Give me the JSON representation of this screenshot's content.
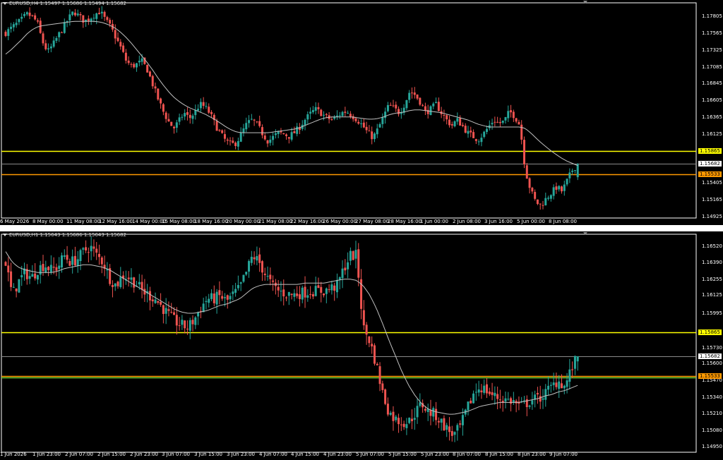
{
  "colors": {
    "background": "#000000",
    "bull": "#26a69a",
    "bear": "#ef5350",
    "ma": "#c0c0c0",
    "axis": "#ffffff",
    "level_yellow": "#ffff00",
    "level_orange": "#ff9900",
    "level_green": "#66cc33",
    "current_price_line": "#8a8a8a"
  },
  "panels": [
    {
      "header": "EURUSD,H4  1.15497 1.15686 1.15494 1.15682",
      "price_labels": [
        "1.17805",
        "1.17565",
        "1.17325",
        "1.17085",
        "1.16845",
        "1.16605",
        "1.16365",
        "1.16125",
        "1.15865",
        "1.15682",
        "1.15533",
        "1.15405",
        "1.15165",
        "1.14925"
      ],
      "time_labels": [
        "6 May 2026",
        "8 May 00:00",
        "11 May 08:00",
        "12 May 16:00",
        "14 May 00:00",
        "15 May 08:00",
        "18 May 16:00",
        "20 May 00:00",
        "21 May 08:00",
        "22 May 16:00",
        "26 May 00:00",
        "27 May 08:00",
        "28 May 16:00",
        "1 Jun 00:00",
        "2 Jun 08:00",
        "3 Jun 16:00",
        "5 Jun 00:00",
        "8 Jun 08:00"
      ],
      "level_tags": [
        {
          "price": "1.15865",
          "color": "#ffff00"
        },
        {
          "price": "1.15682",
          "color": "#ffffff"
        },
        {
          "price": "1.15533",
          "color": "#ff9900"
        }
      ]
    },
    {
      "header": "EURUSD,H1  1.15643 1.15686 1.15643 1.15682",
      "price_labels": [
        "1.16520",
        "1.16390",
        "1.16255",
        "1.16125",
        "1.15995",
        "1.15865",
        "1.15730",
        "1.15682",
        "1.15600",
        "1.15533",
        "1.15470",
        "1.15340",
        "1.15210",
        "1.15080",
        "1.14950"
      ],
      "time_labels": [
        "1 Jun 2026",
        "1 Jun 23:00",
        "2 Jun 07:00",
        "2 Jun 15:00",
        "2 Jun 23:00",
        "3 Jun 07:00",
        "3 Jun 15:00",
        "3 Jun 23:00",
        "4 Jun 07:00",
        "4 Jun 15:00",
        "4 Jun 23:00",
        "5 Jun 07:00",
        "5 Jun 15:00",
        "5 Jun 23:00",
        "8 Jun 07:00",
        "8 Jun 15:00",
        "8 Jun 23:00",
        "9 Jun 07:00"
      ],
      "level_tags": [
        {
          "price": "1.15865",
          "color": "#ffff00"
        },
        {
          "price": "1.15682",
          "color": "#ffffff"
        },
        {
          "price": "1.15533",
          "color": "#ff9900"
        }
      ]
    }
  ],
  "chart_data": [
    {
      "type": "candlestick",
      "symbol": "EURUSD",
      "timeframe": "H4",
      "ohlc_last": {
        "open": 1.15497,
        "high": 1.15686,
        "low": 1.15494,
        "close": 1.15682
      },
      "ylim": [
        1.14925,
        1.1788
      ],
      "x_ticks": [
        "6 May 2026",
        "8 May 00:00",
        "11 May 08:00",
        "12 May 16:00",
        "14 May 00:00",
        "15 May 08:00",
        "18 May 16:00",
        "20 May 00:00",
        "21 May 08:00",
        "22 May 16:00",
        "26 May 00:00",
        "27 May 08:00",
        "28 May 16:00",
        "1 Jun 00:00",
        "2 Jun 08:00",
        "3 Jun 16:00",
        "5 Jun 00:00",
        "8 Jun 08:00"
      ],
      "y_ticks": [
        1.17805,
        1.17565,
        1.17325,
        1.17085,
        1.16845,
        1.16605,
        1.16365,
        1.16125,
        1.15405,
        1.15165,
        1.14925
      ],
      "horizontal_levels": [
        {
          "price": 1.15865,
          "color": "#ffff00"
        },
        {
          "price": 1.15682,
          "color": "#8a8a8a"
        },
        {
          "price": 1.15533,
          "color": "#ff9900"
        }
      ],
      "close_path": [
        1.1752,
        1.1758,
        1.1764,
        1.177,
        1.1778,
        1.1775,
        1.1767,
        1.174,
        1.1725,
        1.1735,
        1.1748,
        1.176,
        1.1772,
        1.1782,
        1.1775,
        1.1768,
        1.1772,
        1.1778,
        1.1782,
        1.177,
        1.176,
        1.1745,
        1.173,
        1.1712,
        1.1705,
        1.1708,
        1.1712,
        1.17,
        1.168,
        1.166,
        1.1642,
        1.1628,
        1.1618,
        1.1628,
        1.164,
        1.1632,
        1.164,
        1.1652,
        1.1648,
        1.1638,
        1.1622,
        1.161,
        1.16,
        1.1595,
        1.1598,
        1.1612,
        1.1625,
        1.163,
        1.1622,
        1.161,
        1.16,
        1.1606,
        1.1612,
        1.161,
        1.1607,
        1.1612,
        1.162,
        1.163,
        1.1638,
        1.1645,
        1.164,
        1.1634,
        1.163,
        1.1634,
        1.164,
        1.1642,
        1.1636,
        1.163,
        1.1622,
        1.1612,
        1.1605,
        1.1618,
        1.1635,
        1.165,
        1.1646,
        1.164,
        1.1652,
        1.167,
        1.1665,
        1.1655,
        1.164,
        1.1645,
        1.1652,
        1.164,
        1.163,
        1.1622,
        1.163,
        1.1622,
        1.1612,
        1.1607,
        1.1602,
        1.161,
        1.162,
        1.163,
        1.1625,
        1.1628,
        1.1642,
        1.1635,
        1.1622,
        1.156,
        1.1532,
        1.1515,
        1.151,
        1.152,
        1.1528,
        1.1536,
        1.153,
        1.1545,
        1.156,
        1.15682
      ],
      "ma_path": [
        1.1722,
        1.1728,
        1.1735,
        1.1742,
        1.175,
        1.1756,
        1.176,
        1.1762,
        1.1763,
        1.1764,
        1.1765,
        1.1766,
        1.1767,
        1.1768,
        1.1768,
        1.1768,
        1.1768,
        1.1768,
        1.1767,
        1.1765,
        1.1762,
        1.1758,
        1.1752,
        1.1745,
        1.1737,
        1.1728,
        1.1719,
        1.171,
        1.17,
        1.1689,
        1.1679,
        1.167,
        1.1662,
        1.1656,
        1.1651,
        1.1647,
        1.1644,
        1.1641,
        1.1638,
        1.1634,
        1.163,
        1.1625,
        1.162,
        1.1616,
        1.1613,
        1.1612,
        1.1612,
        1.1612,
        1.1612,
        1.1612,
        1.1612,
        1.1613,
        1.1614,
        1.1615,
        1.1616,
        1.1617,
        1.1619,
        1.1622,
        1.1625,
        1.1628,
        1.1631,
        1.1633,
        1.1634,
        1.1634,
        1.1634,
        1.1634,
        1.1634,
        1.1633,
        1.1632,
        1.1631,
        1.1631,
        1.1632,
        1.1634,
        1.1637,
        1.1639,
        1.164,
        1.1641,
        1.1643,
        1.1644,
        1.1644,
        1.1643,
        1.1642,
        1.1641,
        1.164,
        1.1638,
        1.1636,
        1.1634,
        1.1632,
        1.163,
        1.1627,
        1.1624,
        1.1622,
        1.162,
        1.162,
        1.162,
        1.162,
        1.162,
        1.162,
        1.162,
        1.1618,
        1.1612,
        1.1605,
        1.1598,
        1.1592,
        1.1586,
        1.1581,
        1.1576,
        1.1572,
        1.1569,
        1.1566
      ]
    },
    {
      "type": "candlestick",
      "symbol": "EURUSD",
      "timeframe": "H1",
      "ohlc_last": {
        "open": 1.15643,
        "high": 1.15686,
        "low": 1.15643,
        "close": 1.15682
      },
      "ylim": [
        1.1495,
        1.1658
      ],
      "x_ticks": [
        "1 Jun 2026",
        "1 Jun 23:00",
        "2 Jun 07:00",
        "2 Jun 15:00",
        "2 Jun 23:00",
        "3 Jun 07:00",
        "3 Jun 15:00",
        "3 Jun 23:00",
        "4 Jun 07:00",
        "4 Jun 15:00",
        "4 Jun 23:00",
        "5 Jun 07:00",
        "5 Jun 15:00",
        "5 Jun 23:00",
        "8 Jun 07:00",
        "8 Jun 15:00",
        "8 Jun 23:00",
        "9 Jun 07:00"
      ],
      "y_ticks": [
        1.1652,
        1.1639,
        1.16255,
        1.16125,
        1.15995,
        1.1573,
        1.156,
        1.1547,
        1.1534,
        1.1521,
        1.1508,
        1.1495
      ],
      "horizontal_levels": [
        {
          "price": 1.15865,
          "color": "#ffff00"
        },
        {
          "price": 1.15682,
          "color": "#8a8a8a"
        },
        {
          "price": 1.15533,
          "color": "#ff9900"
        },
        {
          "price": 1.1552,
          "color": "#66cc33"
        }
      ],
      "close_path": [
        1.164,
        1.1615,
        1.1625,
        1.1632,
        1.1628,
        1.1635,
        1.1638,
        1.1634,
        1.1636,
        1.1645,
        1.164,
        1.1642,
        1.1648,
        1.1652,
        1.1645,
        1.164,
        1.1628,
        1.1622,
        1.163,
        1.1628,
        1.1624,
        1.1618,
        1.1615,
        1.1612,
        1.1606,
        1.16,
        1.1595,
        1.1592,
        1.159,
        1.1596,
        1.1605,
        1.1612,
        1.1612,
        1.1614,
        1.161,
        1.1615,
        1.162,
        1.1632,
        1.1645,
        1.164,
        1.163,
        1.1622,
        1.1618,
        1.1616,
        1.1615,
        1.1616,
        1.1617,
        1.1618,
        1.1618,
        1.1618,
        1.162,
        1.1622,
        1.1635,
        1.1645,
        1.1645,
        1.159,
        1.158,
        1.1562,
        1.154,
        1.1525,
        1.152,
        1.1518,
        1.1518,
        1.1525,
        1.1532,
        1.1526,
        1.1524,
        1.1518,
        1.1512,
        1.1508,
        1.1515,
        1.1528,
        1.154,
        1.1545,
        1.1542,
        1.1538,
        1.1536,
        1.1535,
        1.1534,
        1.153,
        1.1532,
        1.1535,
        1.1536,
        1.154,
        1.1545,
        1.155,
        1.1545,
        1.1558,
        1.15682
      ],
      "ma_path": [
        1.1648,
        1.164,
        1.1636,
        1.1634,
        1.1633,
        1.1632,
        1.1632,
        1.1632,
        1.1633,
        1.1635,
        1.1636,
        1.1637,
        1.1638,
        1.1638,
        1.1637,
        1.1636,
        1.1634,
        1.1631,
        1.1628,
        1.1625,
        1.1622,
        1.1619,
        1.1616,
        1.1613,
        1.161,
        1.1607,
        1.1604,
        1.1602,
        1.1601,
        1.1601,
        1.1602,
        1.1603,
        1.1605,
        1.1607,
        1.1608,
        1.161,
        1.1612,
        1.1616,
        1.162,
        1.1622,
        1.1623,
        1.1623,
        1.1623,
        1.1623,
        1.1623,
        1.1623,
        1.1624,
        1.1624,
        1.1624,
        1.1624,
        1.1625,
        1.1626,
        1.1627,
        1.1627,
        1.1626,
        1.1622,
        1.1615,
        1.1605,
        1.1593,
        1.158,
        1.1568,
        1.1556,
        1.1546,
        1.1538,
        1.1532,
        1.1528,
        1.1526,
        1.1525,
        1.1524,
        1.1524,
        1.1525,
        1.1526,
        1.1528,
        1.153,
        1.1531,
        1.1532,
        1.1533,
        1.1533,
        1.1533,
        1.1533,
        1.1534,
        1.1535,
        1.1536,
        1.1538,
        1.1539,
        1.1541,
        1.1542,
        1.1544,
        1.1546
      ]
    }
  ]
}
